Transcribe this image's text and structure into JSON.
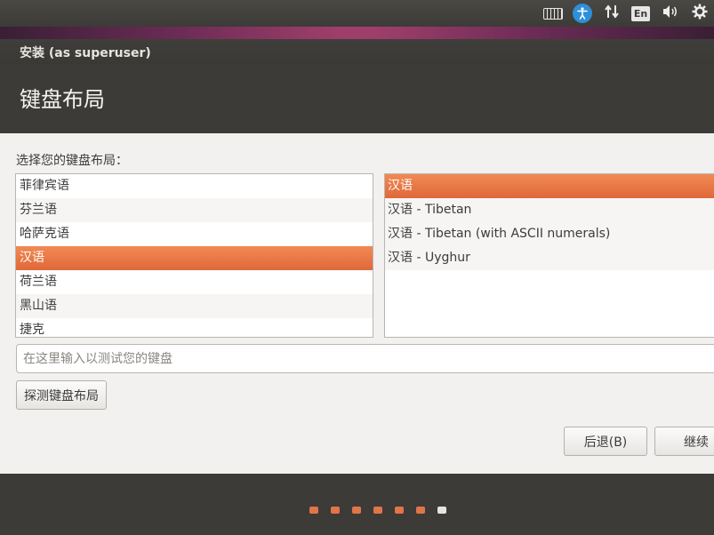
{
  "top_panel": {
    "items": [
      {
        "icon": "keyboard-icon"
      },
      {
        "icon": "accessibility-icon",
        "glyph": "⚲"
      },
      {
        "icon": "network-icon",
        "glyph": "⇅"
      },
      {
        "icon": "language-icon",
        "label": "En"
      },
      {
        "icon": "volume-icon",
        "glyph": "🔊"
      },
      {
        "icon": "gear-icon",
        "glyph": "⚙"
      }
    ]
  },
  "window": {
    "title": "安装 (as superuser)"
  },
  "page": {
    "heading": "键盘布局",
    "prompt": "选择您的键盘布局："
  },
  "layouts": {
    "items": [
      "菲律宾语",
      "芬兰语",
      "哈萨克语",
      "汉语",
      "荷兰语",
      "黑山语",
      "捷克"
    ],
    "selected_index": 3
  },
  "variants": {
    "items": [
      "汉语",
      "汉语 - Tibetan",
      "汉语 - Tibetan (with ASCII numerals)",
      "汉语 - Uyghur"
    ],
    "selected_index": 0
  },
  "test_field": {
    "placeholder": "在这里输入以测试您的键盘",
    "value": ""
  },
  "buttons": {
    "detect": "探测键盘布局",
    "back": "后退(B)",
    "continue": "继续"
  },
  "progress": {
    "total_steps": 7,
    "current_step": 7
  },
  "colors": {
    "accent": "#e0683a",
    "header_bg": "#3c3b37"
  }
}
